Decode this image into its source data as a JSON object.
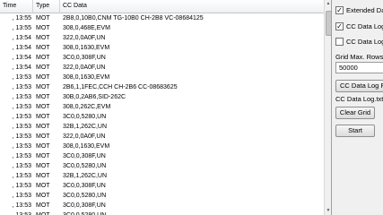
{
  "grid": {
    "columns": [
      "Time",
      "Type",
      "CC Data"
    ],
    "rows": [
      {
        "time": ", 13:55",
        "type": "MOT",
        "cc": "2B8,0,10B0,CNM TG-10B0 CH-2B8 VC-08684125"
      },
      {
        "time": ", 13:55",
        "type": "MOT",
        "cc": "308,0,468E,EVM"
      },
      {
        "time": ", 13:54",
        "type": "MOT",
        "cc": "322,0,0A0F,UN"
      },
      {
        "time": ", 13:54",
        "type": "MOT",
        "cc": "308,0,1630,EVM"
      },
      {
        "time": ", 13:54",
        "type": "MOT",
        "cc": "3C0,0,308F,UN"
      },
      {
        "time": ", 13:54",
        "type": "MOT",
        "cc": "322,0,0A0F,UN"
      },
      {
        "time": ", 13:53",
        "type": "MOT",
        "cc": "308,0,1630,EVM"
      },
      {
        "time": ", 13:53",
        "type": "MOT",
        "cc": "2B6,1,1FEC,CCH CH-2B6 CC-08683625"
      },
      {
        "time": ", 13:53",
        "type": "MOT",
        "cc": "30B,0,2AB6,SID-262C"
      },
      {
        "time": ", 13:53",
        "type": "MOT",
        "cc": "308,0,262C,EVM"
      },
      {
        "time": ", 13:53",
        "type": "MOT",
        "cc": "3C0,0,5280,UN"
      },
      {
        "time": ", 13:53",
        "type": "MOT",
        "cc": "32B,1,262C,UN"
      },
      {
        "time": ", 13:53",
        "type": "MOT",
        "cc": "322,0,0A0F,UN"
      },
      {
        "time": ", 13:53",
        "type": "MOT",
        "cc": "308,0,1630,EVM"
      },
      {
        "time": ", 13:53",
        "type": "MOT",
        "cc": "3C0,0,308F,UN"
      },
      {
        "time": ", 13:53",
        "type": "MOT",
        "cc": "3C0,0,5280,UN"
      },
      {
        "time": ", 13:53",
        "type": "MOT",
        "cc": "32B,1,262C,UN"
      },
      {
        "time": ", 13:53",
        "type": "MOT",
        "cc": "3C0,0,308F,UN"
      },
      {
        "time": ", 13:53",
        "type": "MOT",
        "cc": "3C0,0,5280,UN"
      },
      {
        "time": ", 13:53",
        "type": "MOT",
        "cc": "3C0,0,308F,UN"
      },
      {
        "time": ", 13:53",
        "type": "MOT",
        "cc": "3C0,0,5280,UN"
      }
    ]
  },
  "panel": {
    "extended_data": {
      "label": "Extended Data",
      "checked": true
    },
    "cc_log_1": {
      "label": "CC Data Log T",
      "checked": true
    },
    "cc_log_2": {
      "label": "CC Data Log T",
      "checked": false
    },
    "grid_max_rows_label": "Grid Max. Rows",
    "grid_max_rows_value": "50000",
    "log_file_button": "CC Data Log File",
    "log_file_name": "CC Data Log.txt",
    "clear_button": "Clear Grid",
    "start_button": "Start"
  }
}
